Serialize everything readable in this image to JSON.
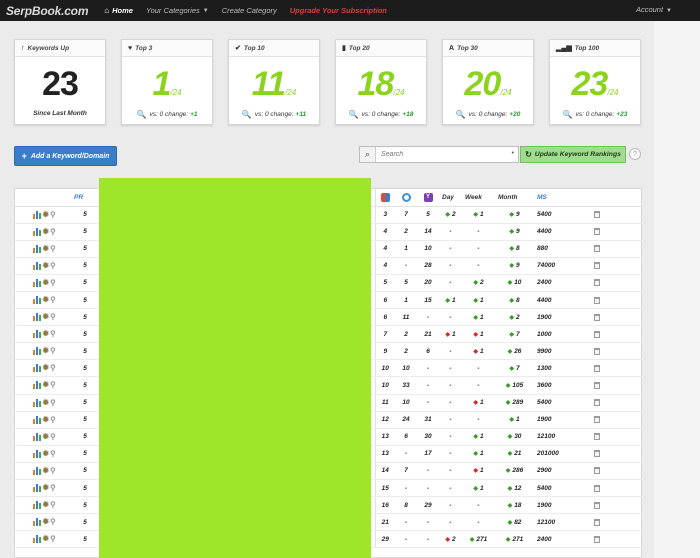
{
  "topbar": {
    "brand": "SerpBook.com",
    "nav": {
      "home": "Home",
      "categories": "Your Categories",
      "create": "Create Category",
      "upgrade": "Upgrade Your Subscription"
    },
    "account": "Account"
  },
  "cards": [
    {
      "title": "Keywords Up",
      "icon": "arrow-up-icon",
      "value": "23",
      "denominator": "",
      "footer": "Since Last Month",
      "change": ""
    },
    {
      "title": "Top 3",
      "icon": "heart-icon",
      "value": "1",
      "denominator": "/24",
      "footer": "vs: 0 change:",
      "change": "+1"
    },
    {
      "title": "Top 10",
      "icon": "check-icon",
      "value": "11",
      "denominator": "/24",
      "footer": "vs: 0 change:",
      "change": "+11"
    },
    {
      "title": "Top 20",
      "icon": "bookmark-icon",
      "value": "18",
      "denominator": "/24",
      "footer": "vs: 0 change:",
      "change": "+18"
    },
    {
      "title": "Top 30",
      "icon": "font-icon",
      "value": "20",
      "denominator": "/24",
      "footer": "vs: 0 change:",
      "change": "+20"
    },
    {
      "title": "Top 100",
      "icon": "signal-icon",
      "value": "23",
      "denominator": "/24",
      "footer": "vs: 0 change:",
      "change": "+23"
    }
  ],
  "controls": {
    "add_label": "Add a Keyword/Domain",
    "search_placeholder": "Search",
    "update_label": "Update Keyword Rankings",
    "help": "?"
  },
  "table": {
    "headers": {
      "pr": "PR",
      "day": "Day",
      "week": "Week",
      "month": "Month",
      "ms": "MS"
    },
    "rows": [
      {
        "pr": "5",
        "g": "3",
        "b": "7",
        "y": "5",
        "day": "2",
        "day_dir": "up",
        "week": "1",
        "week_dir": "up",
        "month": "9",
        "month_dir": "up",
        "ms": "5400"
      },
      {
        "pr": "5",
        "g": "4",
        "b": "2",
        "y": "14",
        "day": "-",
        "day_dir": "",
        "week": "-",
        "week_dir": "",
        "month": "9",
        "month_dir": "up",
        "ms": "4400"
      },
      {
        "pr": "5",
        "g": "4",
        "b": "1",
        "y": "10",
        "day": "-",
        "day_dir": "",
        "week": "-",
        "week_dir": "",
        "month": "8",
        "month_dir": "up",
        "ms": "880"
      },
      {
        "pr": "5",
        "g": "4",
        "b": "-",
        "y": "28",
        "day": "-",
        "day_dir": "",
        "week": "-",
        "week_dir": "",
        "month": "9",
        "month_dir": "up",
        "ms": "74000"
      },
      {
        "pr": "5",
        "g": "5",
        "b": "5",
        "y": "20",
        "day": "-",
        "day_dir": "",
        "week": "2",
        "week_dir": "up",
        "month": "10",
        "month_dir": "up",
        "ms": "2400"
      },
      {
        "pr": "5",
        "g": "6",
        "b": "1",
        "y": "15",
        "day": "1",
        "day_dir": "up",
        "week": "1",
        "week_dir": "up",
        "month": "8",
        "month_dir": "up",
        "ms": "4400"
      },
      {
        "pr": "5",
        "g": "6",
        "b": "11",
        "y": "-",
        "day": "-",
        "day_dir": "",
        "week": "1",
        "week_dir": "up",
        "month": "2",
        "month_dir": "up",
        "ms": "1900"
      },
      {
        "pr": "5",
        "g": "7",
        "b": "2",
        "y": "21",
        "day": "1",
        "day_dir": "down",
        "week": "1",
        "week_dir": "down",
        "month": "7",
        "month_dir": "up",
        "ms": "1000"
      },
      {
        "pr": "5",
        "g": "9",
        "b": "2",
        "y": "6",
        "day": "-",
        "day_dir": "",
        "week": "1",
        "week_dir": "down",
        "month": "26",
        "month_dir": "up",
        "ms": "9900"
      },
      {
        "pr": "5",
        "g": "10",
        "b": "10",
        "y": "-",
        "day": "-",
        "day_dir": "",
        "week": "-",
        "week_dir": "",
        "month": "7",
        "month_dir": "up",
        "ms": "1300"
      },
      {
        "pr": "5",
        "g": "10",
        "b": "33",
        "y": "-",
        "day": "-",
        "day_dir": "",
        "week": "-",
        "week_dir": "",
        "month": "105",
        "month_dir": "up",
        "ms": "3600"
      },
      {
        "pr": "5",
        "g": "11",
        "b": "10",
        "y": "-",
        "day": "-",
        "day_dir": "",
        "week": "1",
        "week_dir": "down",
        "month": "289",
        "month_dir": "up",
        "ms": "5400"
      },
      {
        "pr": "5",
        "g": "12",
        "b": "24",
        "y": "31",
        "day": "-",
        "day_dir": "",
        "week": "-",
        "week_dir": "",
        "month": "1",
        "month_dir": "up",
        "ms": "1900"
      },
      {
        "pr": "5",
        "g": "13",
        "b": "6",
        "y": "30",
        "day": "-",
        "day_dir": "",
        "week": "1",
        "week_dir": "up",
        "month": "30",
        "month_dir": "up",
        "ms": "12100"
      },
      {
        "pr": "5",
        "g": "13",
        "b": "-",
        "y": "17",
        "day": "-",
        "day_dir": "",
        "week": "1",
        "week_dir": "up",
        "month": "21",
        "month_dir": "up",
        "ms": "201000"
      },
      {
        "pr": "5",
        "g": "14",
        "b": "7",
        "y": "-",
        "day": "-",
        "day_dir": "",
        "week": "1",
        "week_dir": "down",
        "month": "286",
        "month_dir": "up",
        "ms": "2900"
      },
      {
        "pr": "5",
        "g": "15",
        "b": "-",
        "y": "-",
        "day": "-",
        "day_dir": "",
        "week": "1",
        "week_dir": "up",
        "month": "12",
        "month_dir": "up",
        "ms": "5400"
      },
      {
        "pr": "5",
        "g": "16",
        "b": "8",
        "y": "29",
        "day": "-",
        "day_dir": "",
        "week": "-",
        "week_dir": "",
        "month": "18",
        "month_dir": "up",
        "ms": "1900"
      },
      {
        "pr": "5",
        "g": "21",
        "b": "-",
        "y": "-",
        "day": "-",
        "day_dir": "",
        "week": "-",
        "week_dir": "",
        "month": "82",
        "month_dir": "up",
        "ms": "12100"
      },
      {
        "pr": "5",
        "g": "29",
        "b": "-",
        "y": "-",
        "day": "2",
        "day_dir": "down",
        "week": "271",
        "week_dir": "up",
        "month": "271",
        "month_dir": "up",
        "ms": "2400"
      }
    ]
  },
  "colors": {
    "accent": "#3a7ec9",
    "green": "#8bd31e",
    "redacted": "#9fe62a",
    "topbar": "#1c1c1c"
  }
}
